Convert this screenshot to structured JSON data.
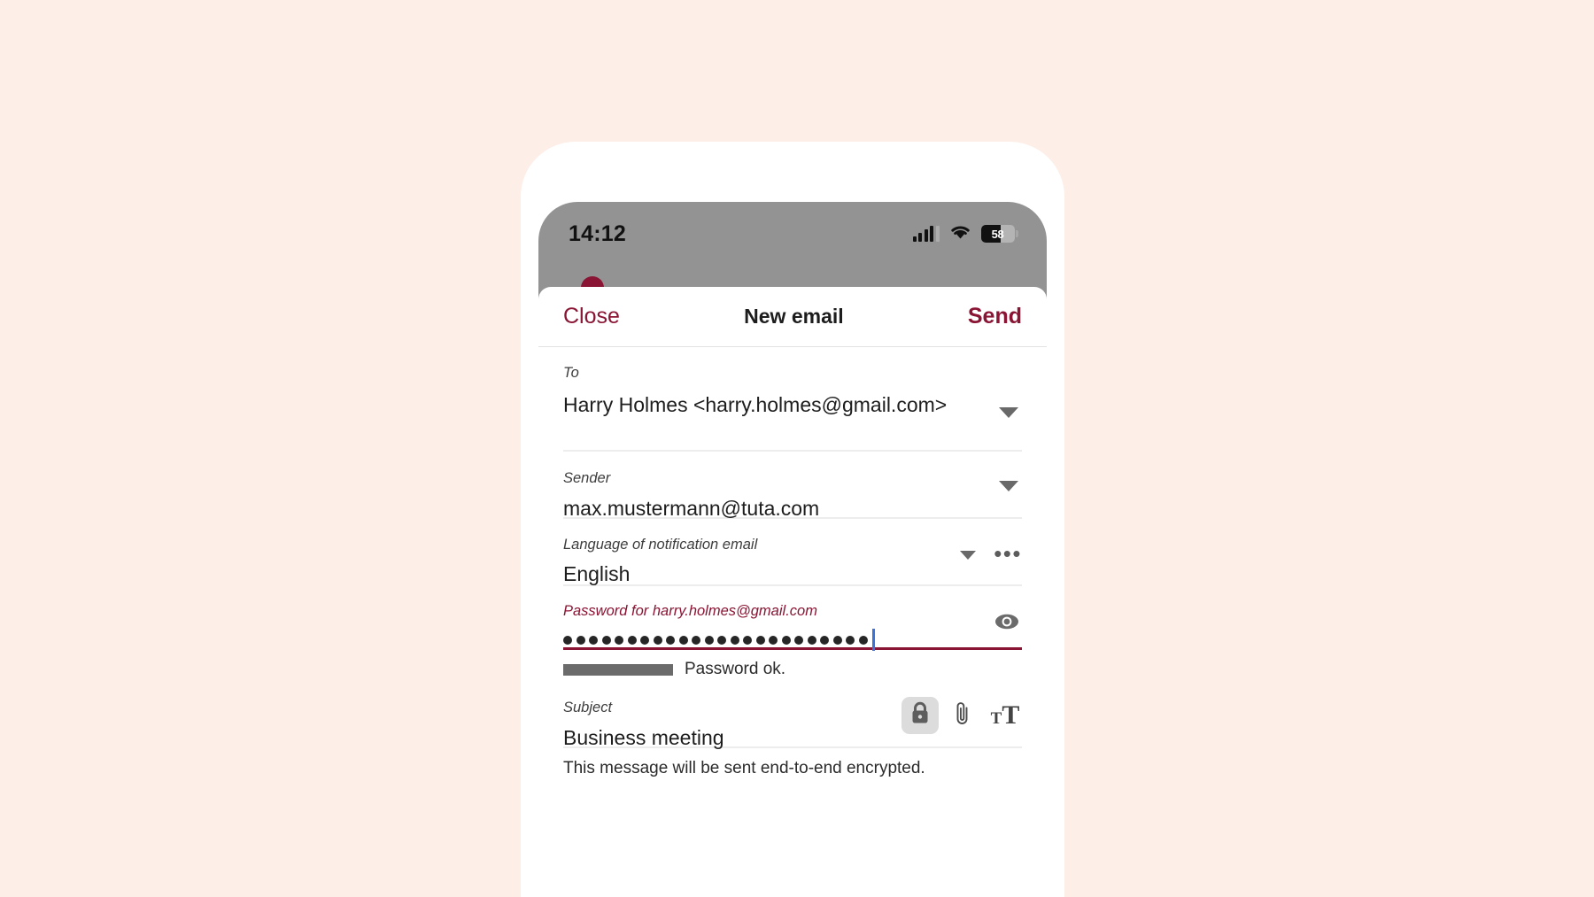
{
  "background_color": "#FDEEE7",
  "accent_color": "#8A1433",
  "status_bar": {
    "time": "14:12",
    "battery_percent": "58",
    "cellular_icon": "cellular-bars-icon",
    "wifi_icon": "wifi-icon",
    "battery_icon": "battery-icon"
  },
  "modal": {
    "close_label": "Close",
    "title": "New email",
    "send_label": "Send"
  },
  "fields": {
    "to": {
      "label": "To",
      "value": "Harry Holmes <harry.holmes@gmail.com>",
      "expand_icon": "chevron-down-icon"
    },
    "sender": {
      "label": "Sender",
      "value": "max.mustermann@tuta.com",
      "expand_icon": "chevron-down-icon"
    },
    "language": {
      "label": "Language of notification email",
      "value": "English",
      "expand_icon": "chevron-down-icon",
      "more_icon": "more-options-icon",
      "more_label": "•••"
    },
    "password": {
      "label": "Password for harry.holmes@gmail.com",
      "masked_value": "●●●●●●●●●●●●●●●●●●●●●●●●",
      "dot_count": 24,
      "reveal_icon": "eye-icon",
      "strength_text": "Password ok.",
      "strength_fill_percent": 100
    },
    "subject": {
      "label": "Subject",
      "value": "Business meeting"
    }
  },
  "toolbar": {
    "encryption_toggle_icon": "lock-closed-icon",
    "attachment_icon": "paperclip-icon",
    "font_size_icon": "font-size-icon",
    "font_size_small": "T",
    "font_size_large": "T"
  },
  "encryption_note": "This message will be sent end-to-end encrypted."
}
